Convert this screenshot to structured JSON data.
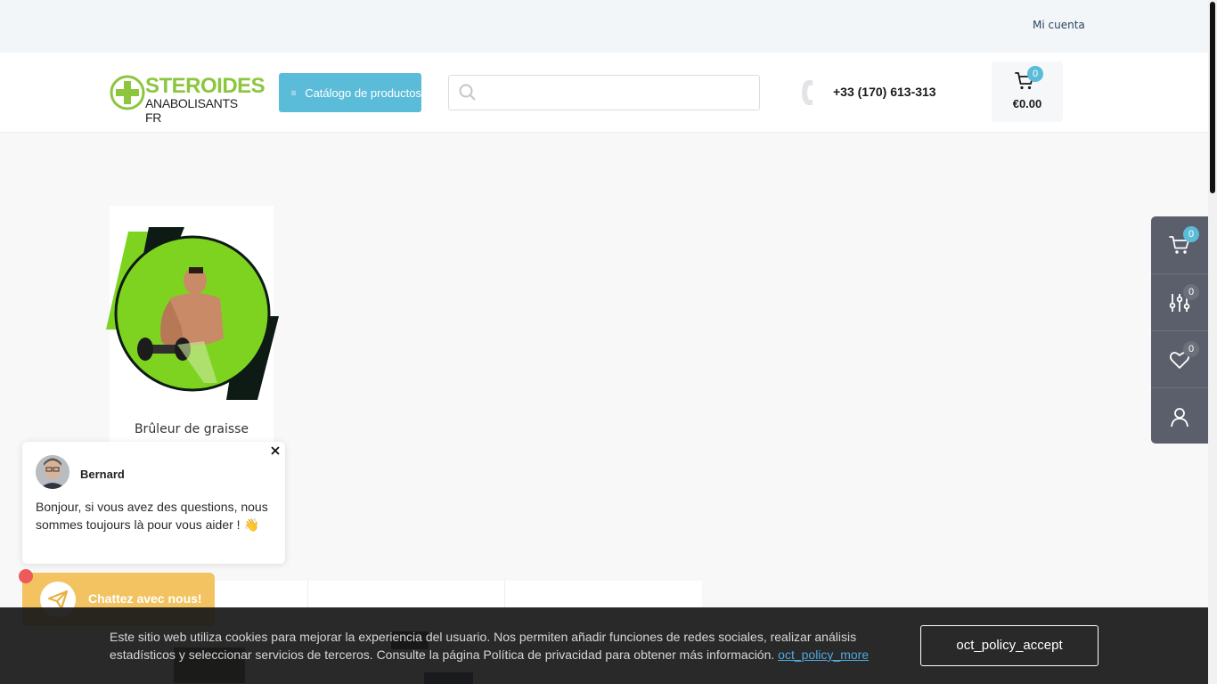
{
  "topbar": {
    "account_label": "Mi cuenta"
  },
  "header": {
    "logo": {
      "line1": "STEROIDES",
      "line2": "ANABOLISANTS FR",
      "icon": "plus-cross-icon"
    },
    "catalog_label": "Catálogo de productos",
    "search": {
      "placeholder": "",
      "icon": "search-icon"
    },
    "phone": "+33 (170) 613-313",
    "cart": {
      "count": "0",
      "total": "€0.00"
    }
  },
  "category": {
    "label": "Brûleur de graisse"
  },
  "chat": {
    "agent_name": "Bernard",
    "message": "Bonjour, si vous avez des questions, nous sommes toujours là pour vous aider ! 👋",
    "button_label": "Chattez avec nous!"
  },
  "cookie": {
    "text": "Este sitio web utiliza cookies para mejorar la experiencia del usuario. Nos permiten añadir funciones de redes sociales, realizar análisis estadísticos y seleccionar servicios de terceros. Consulte la página Política de privacidad para obtener más información.",
    "more_label": "oct_policy_more",
    "accept_label": "oct_policy_accept"
  },
  "side_panel": {
    "cart_count": "0",
    "compare_count": "0",
    "wishlist_count": "0"
  },
  "colors": {
    "accent": "#5bbcd9",
    "brand_green": "#8cc63f",
    "chat_yellow": "#f2c360",
    "panel": "#5a5f6b"
  }
}
